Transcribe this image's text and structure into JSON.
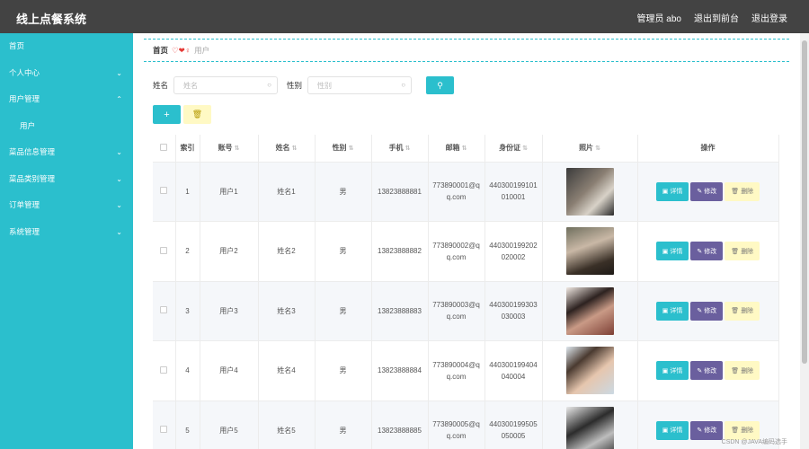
{
  "app_title": "线上点餐系统",
  "header_nav": {
    "user": "管理员 abo",
    "frontend": "退出到前台",
    "logout": "退出登录"
  },
  "sidebar": {
    "items": [
      {
        "label": "首页",
        "chevron": ""
      },
      {
        "label": "个人中心",
        "chevron": "⌄"
      },
      {
        "label": "用户管理",
        "chevron": "⌃"
      },
      {
        "label": "用户",
        "chevron": ""
      },
      {
        "label": "菜品信息管理",
        "chevron": "⌄"
      },
      {
        "label": "菜品类别管理",
        "chevron": "⌄"
      },
      {
        "label": "订单管理",
        "chevron": "⌄"
      },
      {
        "label": "系统管理",
        "chevron": "⌄"
      }
    ]
  },
  "breadcrumb": {
    "home": "首页",
    "sep": "♡❤♀",
    "current": "用户"
  },
  "search": {
    "name_label": "姓名",
    "name_placeholder": "姓名",
    "gender_label": "性别",
    "gender_placeholder": "性别",
    "button_icon": "search-icon"
  },
  "actions": {
    "add_icon": "+",
    "bulk_delete_icon": "🗑"
  },
  "table": {
    "headers": [
      "",
      "索引",
      "账号",
      "姓名",
      "性别",
      "手机",
      "邮箱",
      "身份证",
      "照片",
      "操作"
    ],
    "sortable": [
      false,
      false,
      true,
      true,
      true,
      true,
      true,
      true,
      true,
      false
    ],
    "rows": [
      {
        "index": "1",
        "account": "用户1",
        "name": "姓名1",
        "gender": "男",
        "phone": "13823888881",
        "email": "773890001@qq.com",
        "id_card": "440300199101010001",
        "photo": "photo-1"
      },
      {
        "index": "2",
        "account": "用户2",
        "name": "姓名2",
        "gender": "男",
        "phone": "13823888882",
        "email": "773890002@qq.com",
        "id_card": "440300199202020002",
        "photo": "photo-2"
      },
      {
        "index": "3",
        "account": "用户3",
        "name": "姓名3",
        "gender": "男",
        "phone": "13823888883",
        "email": "773890003@qq.com",
        "id_card": "440300199303030003",
        "photo": "photo-3"
      },
      {
        "index": "4",
        "account": "用户4",
        "name": "姓名4",
        "gender": "男",
        "phone": "13823888884",
        "email": "773890004@qq.com",
        "id_card": "440300199404040004",
        "photo": "photo-4"
      },
      {
        "index": "5",
        "account": "用户5",
        "name": "姓名5",
        "gender": "男",
        "phone": "13823888885",
        "email": "773890005@qq.com",
        "id_card": "440300199505050005",
        "photo": "photo-5"
      }
    ],
    "row_actions": {
      "detail": "详情",
      "edit": "修改",
      "delete": "删除"
    }
  },
  "watermark": "CSDN @JAVA编码选手",
  "colors": {
    "accent": "#2bbfcd",
    "header": "#434343",
    "edit": "#6a5f9e",
    "delete": "#fff9c4"
  }
}
